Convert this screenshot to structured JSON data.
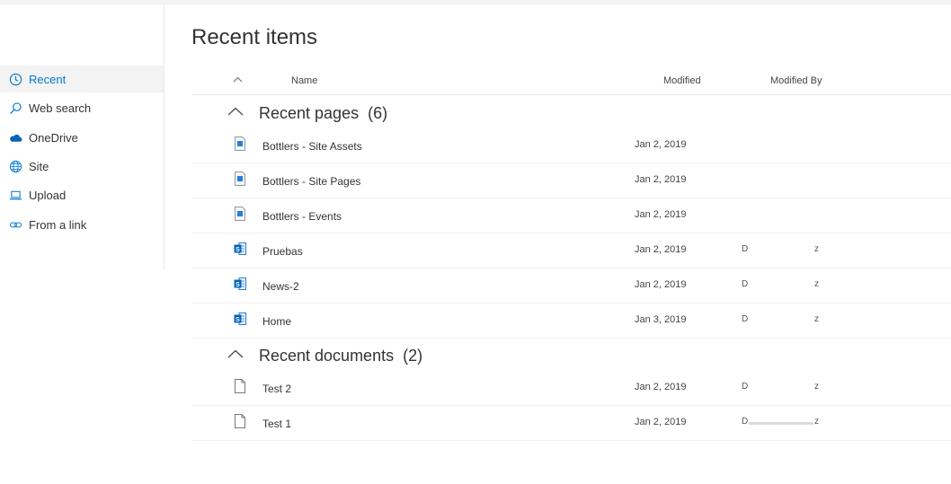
{
  "page": {
    "title": "Recent items"
  },
  "sidebar": {
    "items": [
      {
        "label": "Recent",
        "icon": "clock-icon",
        "active": true
      },
      {
        "label": "Web search",
        "icon": "search-icon"
      },
      {
        "label": "OneDrive",
        "icon": "cloud-icon"
      },
      {
        "label": "Site",
        "icon": "globe-icon"
      },
      {
        "label": "Upload",
        "icon": "laptop-icon"
      },
      {
        "label": "From a link",
        "icon": "link-icon"
      }
    ]
  },
  "columns": {
    "name": "Name",
    "modified": "Modified",
    "modified_by": "Modified By"
  },
  "groups": [
    {
      "title": "Recent pages",
      "count": "(6)",
      "rows": [
        {
          "name": "Bottlers - Site Assets",
          "modified": "Jan 2, 2019",
          "by_first": "",
          "by_last": "",
          "icon": "site-page-icon"
        },
        {
          "name": "Bottlers - Site Pages",
          "modified": "Jan 2, 2019",
          "by_first": "",
          "by_last": "",
          "icon": "site-page-icon"
        },
        {
          "name": "Bottlers - Events",
          "modified": "Jan 2, 2019",
          "by_first": "",
          "by_last": "",
          "icon": "site-page-icon"
        },
        {
          "name": "Pruebas",
          "modified": "Jan 2, 2019",
          "by_first": "D",
          "by_last": "z",
          "icon": "sharepoint-page-icon"
        },
        {
          "name": "News-2",
          "modified": "Jan 2, 2019",
          "by_first": "D",
          "by_last": "z",
          "icon": "sharepoint-page-icon"
        },
        {
          "name": "Home",
          "modified": "Jan 3, 2019",
          "by_first": "D",
          "by_last": "z",
          "icon": "sharepoint-page-icon"
        }
      ]
    },
    {
      "title": "Recent documents",
      "count": "(2)",
      "rows": [
        {
          "name": "Test 2",
          "modified": "Jan 2, 2019",
          "by_first": "D",
          "by_last": "z",
          "icon": "document-icon"
        },
        {
          "name": "Test 1",
          "modified": "Jan 2, 2019",
          "by_first": "D",
          "by_last": "z",
          "icon": "document-icon",
          "smudged": true
        }
      ]
    }
  ],
  "colors": {
    "accent": "#0078d4",
    "sidebar_active": "#f3f3f3",
    "divider": "#eaeaea"
  }
}
